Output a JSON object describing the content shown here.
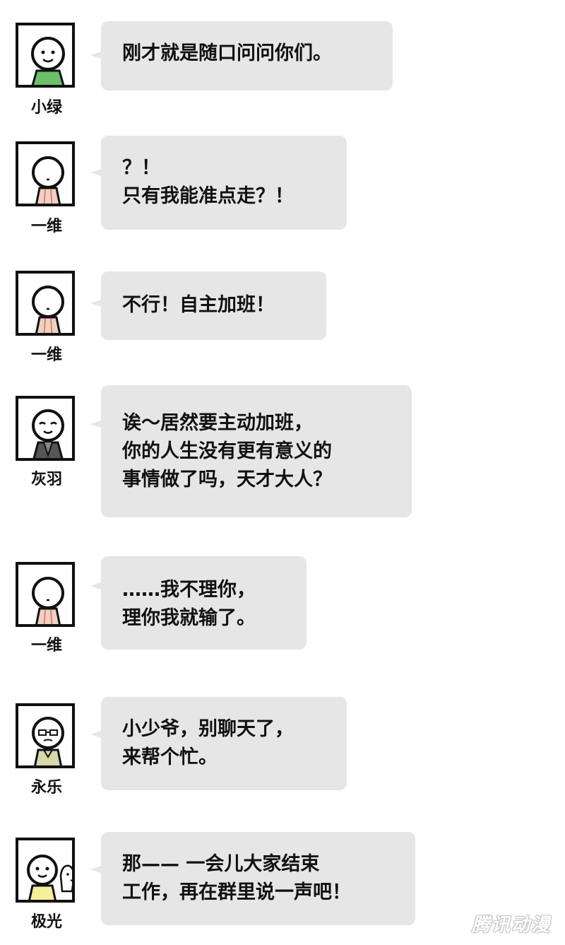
{
  "messages": [
    {
      "sender": "小绿",
      "lines": [
        "刚才就是随口问问你们。"
      ],
      "avatar": "xiaolv-avatar",
      "shirt_color": "#6cc06a"
    },
    {
      "sender": "一维",
      "lines": [
        "？！",
        "只有我能准点走？！"
      ],
      "avatar": "yiwei-avatar",
      "shirt_color": "#f2cfc2"
    },
    {
      "sender": "一维",
      "lines": [
        "不行！自主加班！"
      ],
      "avatar": "yiwei-avatar",
      "shirt_color": "#f2cfc2"
    },
    {
      "sender": "灰羽",
      "lines": [
        "诶～居然要主动加班，",
        "你的人生没有更有意义的",
        "事情做了吗，天才大人？"
      ],
      "avatar": "huiyu-avatar",
      "shirt_color": "#555555"
    },
    {
      "sender": "一维",
      "lines": [
        "……我不理你，",
        "理你我就输了。"
      ],
      "avatar": "yiwei-avatar",
      "shirt_color": "#f2cfc2"
    },
    {
      "sender": "永乐",
      "lines": [
        "小少爷，别聊天了，",
        "来帮个忙。"
      ],
      "avatar": "yongle-avatar",
      "shirt_color": "#d8d8a8"
    },
    {
      "sender": "极光",
      "lines": [
        "那—— 一会儿大家结束",
        "工作，再在群里说一声吧！"
      ],
      "avatar": "jiguang-avatar",
      "shirt_color": "#f6ef9a"
    }
  ],
  "watermark": "腾讯动漫",
  "colors": {
    "bubble": "#e6e6e6",
    "text": "#111111",
    "background": "#ffffff"
  }
}
